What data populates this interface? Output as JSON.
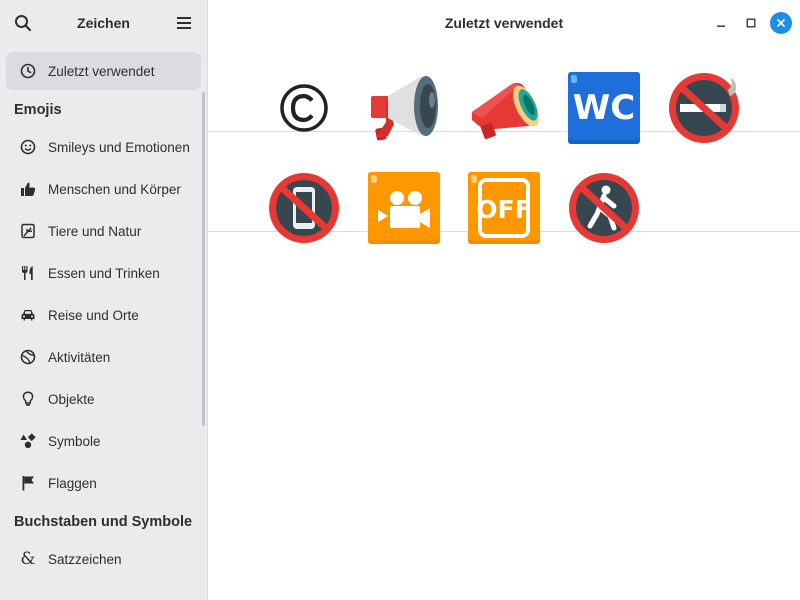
{
  "app": {
    "title": "Zeichen"
  },
  "sidebar": {
    "recent_label": "Zuletzt verwendet",
    "section_emojis": "Emojis",
    "emoji_categories": [
      {
        "label": "Smileys und Emotionen",
        "icon": "smiley-icon"
      },
      {
        "label": "Menschen und Körper",
        "icon": "thumbs-up-icon"
      },
      {
        "label": "Tiere und Natur",
        "icon": "leaf-icon"
      },
      {
        "label": "Essen und Trinken",
        "icon": "fork-knife-icon"
      },
      {
        "label": "Reise und Orte",
        "icon": "car-icon"
      },
      {
        "label": "Aktivitäten",
        "icon": "ball-icon"
      },
      {
        "label": "Objekte",
        "icon": "lightbulb-icon"
      },
      {
        "label": "Symbole",
        "icon": "shapes-icon"
      },
      {
        "label": "Flaggen",
        "icon": "flag-icon"
      }
    ],
    "section_letters": "Buchstaben und Symbole",
    "letter_categories": [
      {
        "label": "Satzzeichen",
        "icon": "ampersand-icon"
      }
    ]
  },
  "main": {
    "title": "Zuletzt verwendet",
    "rows": [
      [
        {
          "name": "copyright-sign",
          "char": "©"
        },
        {
          "name": "loudspeaker",
          "char": "📢"
        },
        {
          "name": "megaphone",
          "char": "📣"
        },
        {
          "name": "water-closet",
          "char": "🚾"
        },
        {
          "name": "no-smoking",
          "char": "🚭"
        }
      ],
      [
        {
          "name": "no-mobile-phones",
          "char": "📵"
        },
        {
          "name": "cinema",
          "char": "🎦"
        },
        {
          "name": "mobile-phone-off",
          "char": "📴"
        },
        {
          "name": "no-pedestrians",
          "char": "🚷"
        }
      ]
    ]
  },
  "colors": {
    "sidebar_bg": "#ebebed",
    "accent_close": "#1a8fe3",
    "emoji_red": "#e53935",
    "emoji_orange": "#ff9800",
    "emoji_blue": "#1a5fd1"
  }
}
